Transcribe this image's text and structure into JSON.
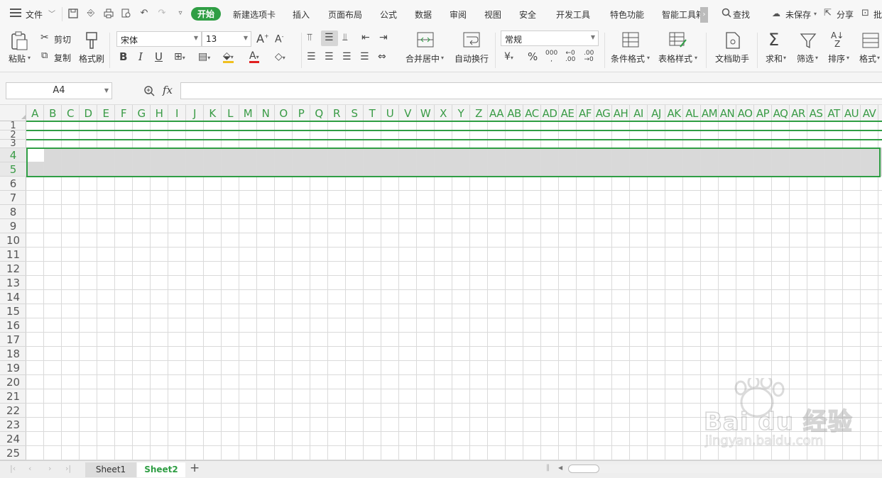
{
  "menu": {
    "file": "文件",
    "items": [
      "开始",
      "新建选项卡",
      "插入",
      "页面布局",
      "公式",
      "数据",
      "审阅",
      "视图",
      "安全",
      "开发工具",
      "特色功能",
      "智能工具箱"
    ],
    "search": "查找",
    "unsaved": "未保存",
    "share": "分享",
    "cut_right": "批"
  },
  "ribbon": {
    "paste": "粘贴",
    "cut": "剪切",
    "copy": "复制",
    "format_painter": "格式刷",
    "font_name": "宋体",
    "font_size": "13",
    "merge_center": "合并居中",
    "wrap_text": "自动换行",
    "number_format": "常规",
    "conditional_format": "条件格式",
    "table_style": "表格样式",
    "doc_assistant": "文档助手",
    "sum": "求和",
    "filter": "筛选",
    "sort": "排序",
    "format": "格式"
  },
  "formula_bar": {
    "name_box": "A4",
    "fx": "fx",
    "value": ""
  },
  "columns": [
    "A",
    "B",
    "C",
    "D",
    "E",
    "F",
    "G",
    "H",
    "I",
    "J",
    "K",
    "L",
    "M",
    "N",
    "O",
    "P",
    "Q",
    "R",
    "S",
    "T",
    "U",
    "V",
    "W",
    "X",
    "Y",
    "Z",
    "AA",
    "AB",
    "AC",
    "AD",
    "AE",
    "AF",
    "AG",
    "AH",
    "AI",
    "AJ",
    "AK",
    "AL",
    "AM",
    "AN",
    "AO",
    "AP",
    "AQ",
    "AR",
    "AS",
    "AT",
    "AU",
    "AV",
    "A"
  ],
  "rows": [
    "1",
    "2",
    "3",
    "4",
    "5",
    "6",
    "7",
    "8",
    "9",
    "10",
    "11",
    "12",
    "13",
    "14",
    "15",
    "16",
    "17",
    "18",
    "19",
    "20",
    "21",
    "22",
    "23",
    "24",
    "25"
  ],
  "selected_cell": "A4",
  "sheets": [
    {
      "name": "Sheet1",
      "active": false
    },
    {
      "name": "Sheet2",
      "active": true
    }
  ],
  "add_sheet": "+",
  "watermark": {
    "brand": "Bai du 经验",
    "url": "jingyan.baidu.com"
  },
  "colors": {
    "accent": "#2f9e44",
    "selection_fill": "#d9d9d9"
  }
}
